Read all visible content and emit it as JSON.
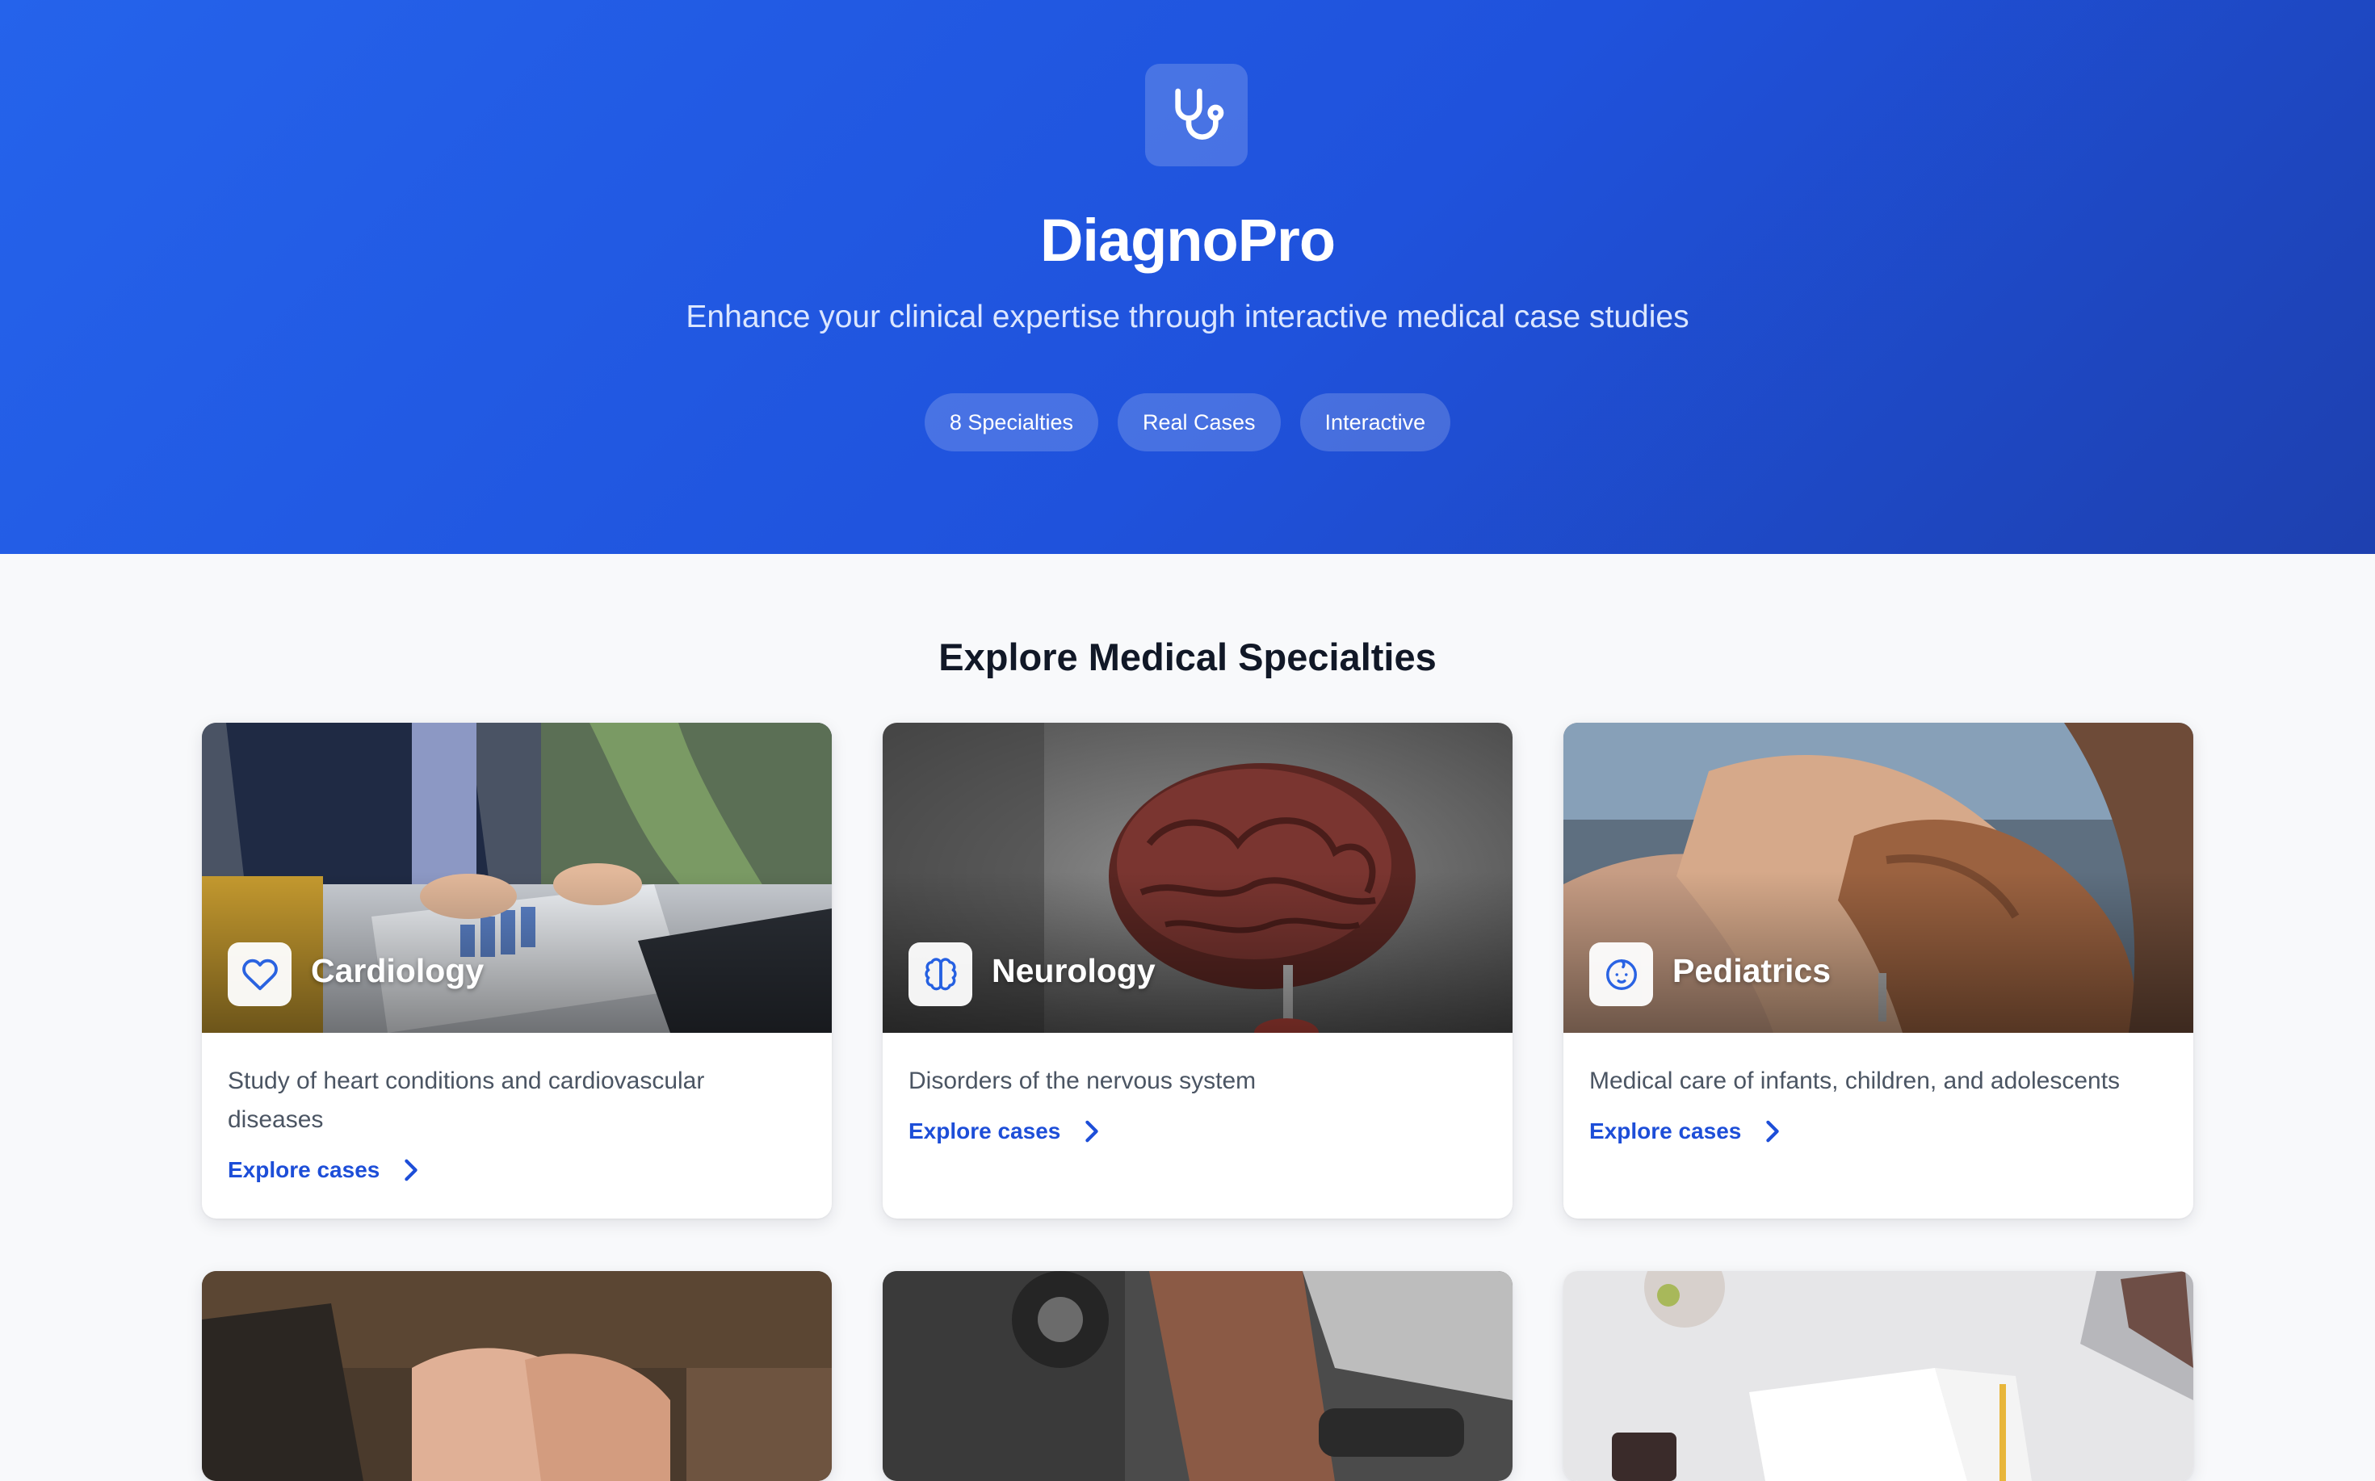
{
  "header": {
    "brand": "DiagnoPro",
    "tagline": "Enhance your clinical expertise through interactive medical case studies",
    "logo_icon": "stethoscope-icon",
    "pills": [
      "8 Specialties",
      "Real Cases",
      "Interactive"
    ]
  },
  "main": {
    "section_title": "Explore Medical Specialties",
    "cards": [
      {
        "name": "Cardiology",
        "description": "Study of heart conditions and cardiovascular diseases",
        "link": "Explore cases",
        "icon": "heart-icon"
      },
      {
        "name": "Neurology",
        "description": "Disorders of the nervous system",
        "link": "Explore cases",
        "icon": "brain-icon"
      },
      {
        "name": "Pediatrics",
        "description": "Medical care of infants, children, and adolescents",
        "link": "Explore cases",
        "icon": "baby-face-icon"
      }
    ]
  },
  "colors": {
    "accent": "#2563eb",
    "hero_gradient_end": "#1e40af",
    "link": "#1d4ed8",
    "page_background": "#f8f9fb"
  }
}
